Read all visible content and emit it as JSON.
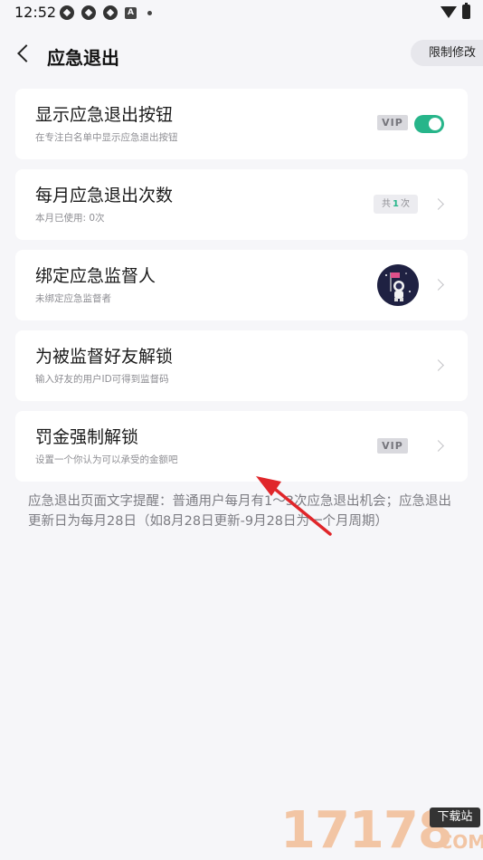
{
  "status_bar": {
    "time": "12:52",
    "notif_badge": "A"
  },
  "header": {
    "title": "应急退出",
    "limit_button": "限制修改"
  },
  "items": [
    {
      "title": "显示应急退出按钮",
      "subtitle": "在专注白名单中显示应急退出按钮",
      "vip": "VIP",
      "toggle_on": true
    },
    {
      "title": "每月应急退出次数",
      "subtitle": "本月已使用: 0次",
      "count_prefix": "共",
      "count": "1",
      "count_suffix": "次"
    },
    {
      "title": "绑定应急监督人",
      "subtitle": "未绑定应急监督者"
    },
    {
      "title": "为被监督好友解锁",
      "subtitle": "输入好友的用户ID可得到监督码"
    },
    {
      "title": "罚金强制解锁",
      "subtitle": "设置一个你认为可以承受的金额吧",
      "vip": "VIP"
    }
  ],
  "note": "应急退出页面文字提醒：普通用户每月有1～3次应急退出机会；应急退出更新日为每月28日（如8月28日更新-9月28日为一个月周期）",
  "watermark": {
    "digits": "17178",
    "chip": "下载站",
    "com": ".COM"
  },
  "colors": {
    "accent": "#27b58a",
    "background": "#f6f6f9",
    "arrow": "#e0262a"
  }
}
